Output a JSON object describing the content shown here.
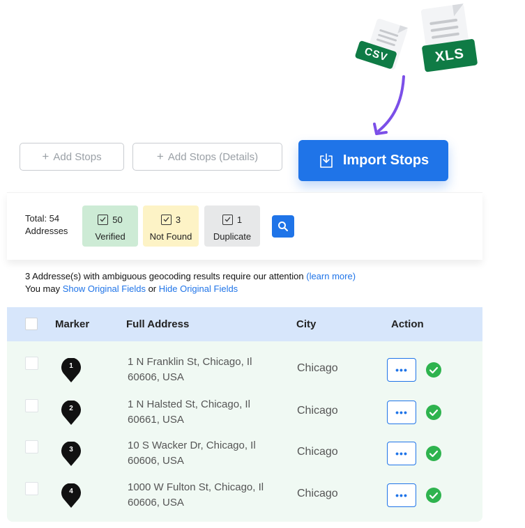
{
  "illustration": {
    "csv_badge": "CSV",
    "xls_badge": "XLS",
    "badge_color": "#0f7b45",
    "arrow_color": "#7b4fe8"
  },
  "toolbar": {
    "add_stops_label": "Add Stops",
    "add_stops_details_label": "Add Stops (Details)",
    "import_label": "Import Stops",
    "accent": "#1f74e8"
  },
  "summary": {
    "total_line1": "Total: 54",
    "total_line2": "Addresses",
    "verified_count": "50",
    "verified_label": "Verified",
    "not_found_count": "3",
    "not_found_label": "Not Found",
    "duplicate_count": "1",
    "duplicate_label": "Duplicate"
  },
  "notice": {
    "line1_text": "3 Addresse(s) with ambiguous geocoding results require our attention ",
    "learn_more": "(learn more)",
    "line2_prefix": "You may ",
    "show_original": "Show Original Fields",
    "or_text": " or ",
    "hide_original": "Hide Original Fields"
  },
  "table": {
    "headers": {
      "marker": "Marker",
      "full_address": "Full Address",
      "city": "City",
      "action": "Action"
    },
    "rows": [
      {
        "marker": "1",
        "address_line1": "1 N Franklin St, Chicago, Il",
        "address_line2": "60606, USA",
        "city": "Chicago",
        "more": "•••"
      },
      {
        "marker": "2",
        "address_line1": "1 N Halsted St, Chicago, Il",
        "address_line2": "60661, USA",
        "city": "Chicago",
        "more": "•••"
      },
      {
        "marker": "3",
        "address_line1": "10 S Wacker Dr, Chicago, Il",
        "address_line2": "60606, USA",
        "city": "Chicago",
        "more": "•••"
      },
      {
        "marker": "4",
        "address_line1": "1000 W Fulton St, Chicago, Il",
        "address_line2": "60606, USA",
        "city": "Chicago",
        "more": "•••"
      }
    ],
    "status_color": "#2eb34e"
  }
}
